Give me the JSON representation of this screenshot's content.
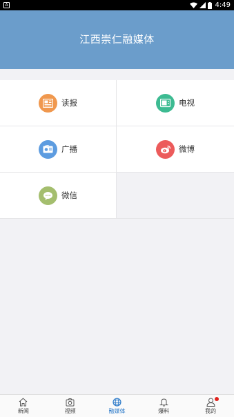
{
  "status_bar": {
    "left_icon": "a-notification-icon",
    "time": "4:49",
    "icons": [
      "wifi-icon",
      "signal-icon",
      "battery-icon"
    ]
  },
  "header": {
    "title": "江西崇仁融媒体"
  },
  "grid": {
    "items": [
      {
        "label": "读报",
        "icon": "newspaper-icon",
        "color": "#f0984e"
      },
      {
        "label": "电视",
        "icon": "tv-icon",
        "color": "#3dbb92"
      },
      {
        "label": "广播",
        "icon": "radio-icon",
        "color": "#5d9ce0"
      },
      {
        "label": "微博",
        "icon": "weibo-icon",
        "color": "#ec5b5b"
      },
      {
        "label": "微信",
        "icon": "wechat-icon",
        "color": "#a4be6e"
      }
    ]
  },
  "bottom_nav": {
    "items": [
      {
        "label": "新闻",
        "icon": "home-icon"
      },
      {
        "label": "视频",
        "icon": "camera-icon"
      },
      {
        "label": "融媒体",
        "icon": "globe-icon",
        "active": true
      },
      {
        "label": "爆料",
        "icon": "bell-icon"
      },
      {
        "label": "我的",
        "icon": "person-icon",
        "badge": true
      }
    ],
    "active_color": "#2a79c9"
  }
}
